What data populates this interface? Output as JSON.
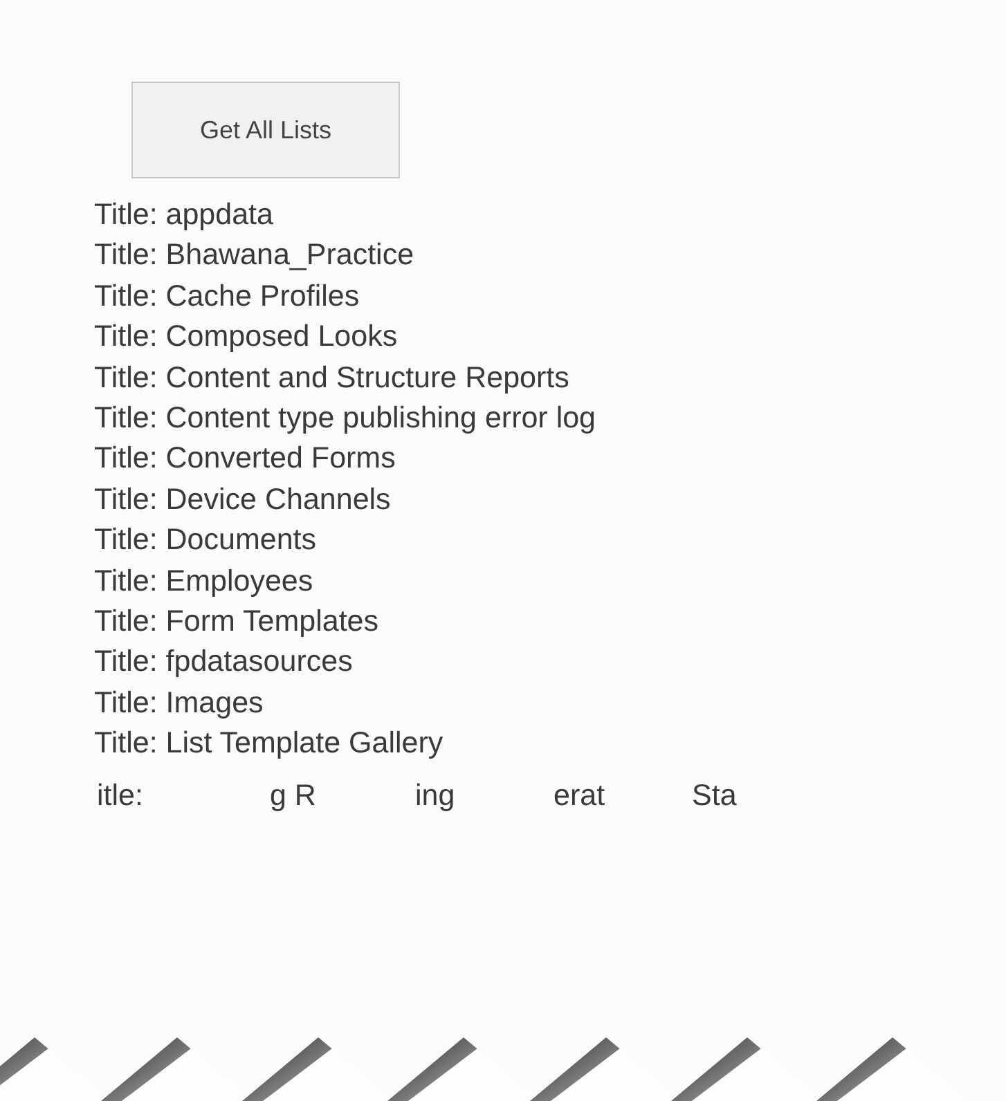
{
  "button": {
    "label": "Get All Lists"
  },
  "titles": [
    "Title: appdata",
    "Title: Bhawana_Practice",
    "Title: Cache Profiles",
    "Title: Composed Looks",
    "Title: Content and Structure Reports",
    "Title: Content type publishing error log",
    "Title: Converted Forms",
    "Title: Device Channels",
    "Title: Documents",
    "Title: Employees",
    "Title: Form Templates",
    "Title: fpdatasources",
    "Title: Images",
    "Title: List Template Gallery"
  ],
  "partial_line": [
    "itle:",
    "g R",
    "ing",
    "erat",
    "Sta"
  ]
}
